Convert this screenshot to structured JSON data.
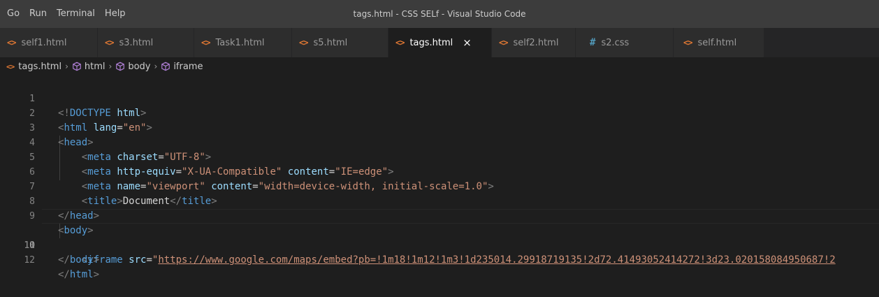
{
  "menu": [
    "Go",
    "Run",
    "Terminal",
    "Help"
  ],
  "window_title": "tags.html - CSS SELf - Visual Studio Code",
  "tabs": [
    {
      "label": "self1.html",
      "icon": "html-icon"
    },
    {
      "label": "s3.html",
      "icon": "html-icon"
    },
    {
      "label": "Task1.html",
      "icon": "html-icon"
    },
    {
      "label": "s5.html",
      "icon": "html-icon"
    },
    {
      "label": "tags.html",
      "icon": "html-icon",
      "active": true,
      "close": "×"
    },
    {
      "label": "self2.html",
      "icon": "html-icon"
    },
    {
      "label": "s2.css",
      "icon": "css-hash-icon"
    },
    {
      "label": "self.html",
      "icon": "html-icon"
    }
  ],
  "icon_glyphs": {
    "html": "<>",
    "css": "#"
  },
  "breadcrumb": [
    "tags.html",
    "html",
    "body",
    "iframe"
  ],
  "line_numbers": [
    "1",
    "2",
    "3",
    "4",
    "5",
    "6",
    "7",
    "8",
    "9",
    "10",
    "11",
    "12"
  ],
  "current_line": "10",
  "code": {
    "l1": {
      "open": "<!",
      "tag": "DOCTYPE",
      "attr": "html",
      "close": ">"
    },
    "l2": {
      "open": "<",
      "tag": "html",
      "attr": "lang",
      "eq": "=",
      "val": "\"en\"",
      "close": ">"
    },
    "l3": {
      "open": "<",
      "tag": "head",
      "close": ">"
    },
    "l4": {
      "open": "<",
      "tag": "meta",
      "attr": "charset",
      "eq": "=",
      "val": "\"UTF-8\"",
      "close": ">"
    },
    "l5": {
      "open": "<",
      "tag": "meta",
      "attr1": "http-equiv",
      "eq1": "=",
      "val1": "\"X-UA-Compatible\"",
      "attr2": "content",
      "eq2": "=",
      "val2": "\"IE=edge\"",
      "close": ">"
    },
    "l6": {
      "open": "<",
      "tag": "meta",
      "attr1": "name",
      "eq1": "=",
      "val1": "\"viewport\"",
      "attr2": "content",
      "eq2": "=",
      "val2": "\"width=device-width, initial-scale=1.0\"",
      "close": ">"
    },
    "l7": {
      "open": "<",
      "tag": "title",
      "close1": ">",
      "text": "Document",
      "open2": "</",
      "tag2": "title",
      "close2": ">"
    },
    "l8": {
      "open": "</",
      "tag": "head",
      "close": ">"
    },
    "l9": {
      "open": "<",
      "tag": "body",
      "close": ">"
    },
    "l10": {
      "open": "<",
      "tag": "iframe",
      "attr": "src",
      "eq": "=",
      "quote": "\"",
      "url": "https://www.google.com/maps/embed?pb=!1m18!1m12!1m3!1d235014.29918719135!2d72.41493052414272!3d23.020158084950687!2"
    },
    "l11": {
      "open": "</",
      "tag": "body",
      "close": ">"
    },
    "l12": {
      "open": "</",
      "tag": "html",
      "close": ">"
    }
  },
  "colors": {
    "tag": "#569cd6",
    "attr": "#9cdcfe",
    "string": "#ce9178",
    "punct": "#808080",
    "html_icon": "#e37933",
    "css_icon": "#519aba"
  }
}
